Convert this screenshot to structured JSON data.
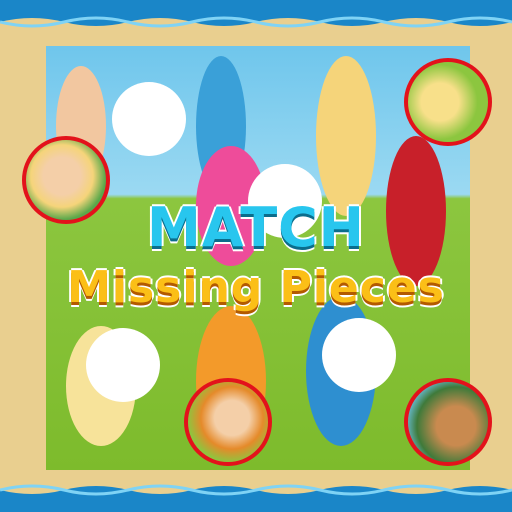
{
  "title": {
    "line1": "MATCH",
    "line2": "Missing Pieces"
  },
  "colors": {
    "sand": "#e9cf8f",
    "water": "#1a86c8",
    "title_blue": "#28c6ee",
    "title_yellow": "#fbbf17",
    "piece_border": "#e3121b"
  },
  "holes": [
    {
      "id": "hole-1"
    },
    {
      "id": "hole-2"
    },
    {
      "id": "hole-3"
    },
    {
      "id": "hole-4"
    }
  ],
  "pieces": [
    {
      "id": "piece-1"
    },
    {
      "id": "piece-2"
    },
    {
      "id": "piece-3"
    },
    {
      "id": "piece-4"
    }
  ]
}
